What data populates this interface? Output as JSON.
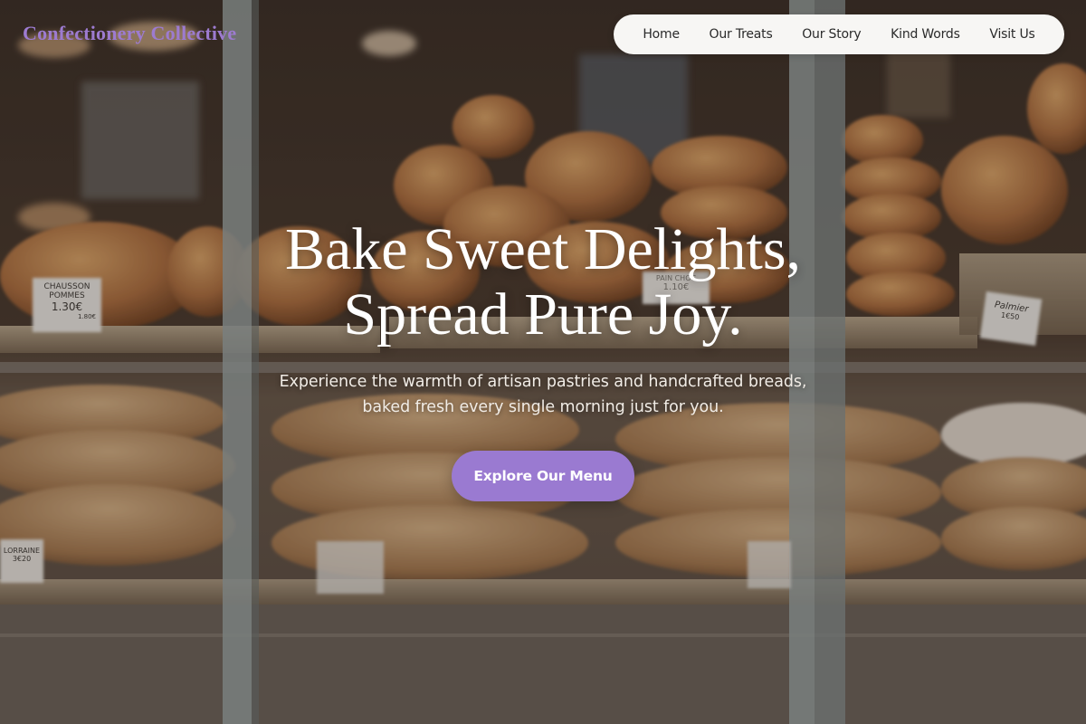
{
  "brand": {
    "name": "Confectionery Collective"
  },
  "nav": {
    "items": [
      {
        "label": "Home"
      },
      {
        "label": "Our Treats"
      },
      {
        "label": "Our Story"
      },
      {
        "label": "Kind Words"
      },
      {
        "label": "Visit Us"
      }
    ]
  },
  "hero": {
    "title_line1": "Bake Sweet Delights,",
    "title_line2": "Spread Pure Joy.",
    "subtitle_line1": "Experience the warmth of artisan pastries and handcrafted breads,",
    "subtitle_line2": "baked fresh every single morning just for you.",
    "cta_label": "Explore Our Menu"
  },
  "background": {
    "price_tags": [
      {
        "line1": "CHAUSSON",
        "line2": "POMMES",
        "line3": "1.30€",
        "line4": "1.80€"
      },
      {
        "line1": "PAIN CHOC",
        "line2": "1.10€"
      },
      {
        "line1": "Palmier",
        "line2": "1€50"
      },
      {
        "line1": "LORRAINE",
        "line2": "3€20"
      }
    ]
  },
  "colors": {
    "accent": "#9a7ad1",
    "brand_text": "#9d7bd0",
    "nav_bg": "#f7f6f4"
  }
}
